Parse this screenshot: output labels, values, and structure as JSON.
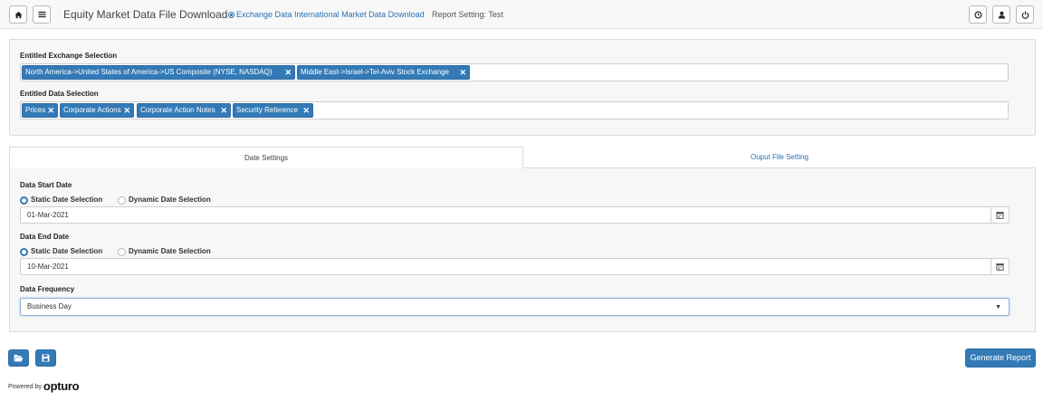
{
  "header": {
    "title": "Equity Market Data File Download",
    "link_label": "Exchange Data International Market Data Download",
    "report_setting": "Report Setting: Test",
    "icons": [
      "home-icon",
      "menu-icon",
      "clock-icon",
      "user-icon",
      "power-icon"
    ]
  },
  "selection": {
    "exchange_label": "Entitled Exchange Selection",
    "exchange_tags": [
      "North America->United States of America->US Composite (NYSE, NASDAQ)",
      "Middle East->Israel->Tel-Aviv Stock Exchange"
    ],
    "data_label": "Entitled Data Selection",
    "data_tags": [
      "Prices",
      "Corporate Actions",
      "Corporate Action Notes",
      "Security Reference"
    ],
    "remove_glyph": "✕"
  },
  "tabs": {
    "date_settings": "Date Settings",
    "output_file_setting": "Ouput File Setting"
  },
  "dates": {
    "start_label": "Data Start Date",
    "end_label": "Data End Date",
    "static_option": "Static Date Selection",
    "dynamic_option": "Dynamic Date Selection",
    "start_value": "01-Mar-2021",
    "end_value": "10-Mar-2021",
    "selected_option": "static"
  },
  "frequency": {
    "label": "Data Frequency",
    "value": "Business Day"
  },
  "footer": {
    "generate_label": "Generate Report",
    "powered_by": "Powered by",
    "brand": "opturo"
  },
  "colors": {
    "accent": "#337ab7",
    "link": "#2a72b5",
    "panel_bg": "#f7f7f7"
  }
}
